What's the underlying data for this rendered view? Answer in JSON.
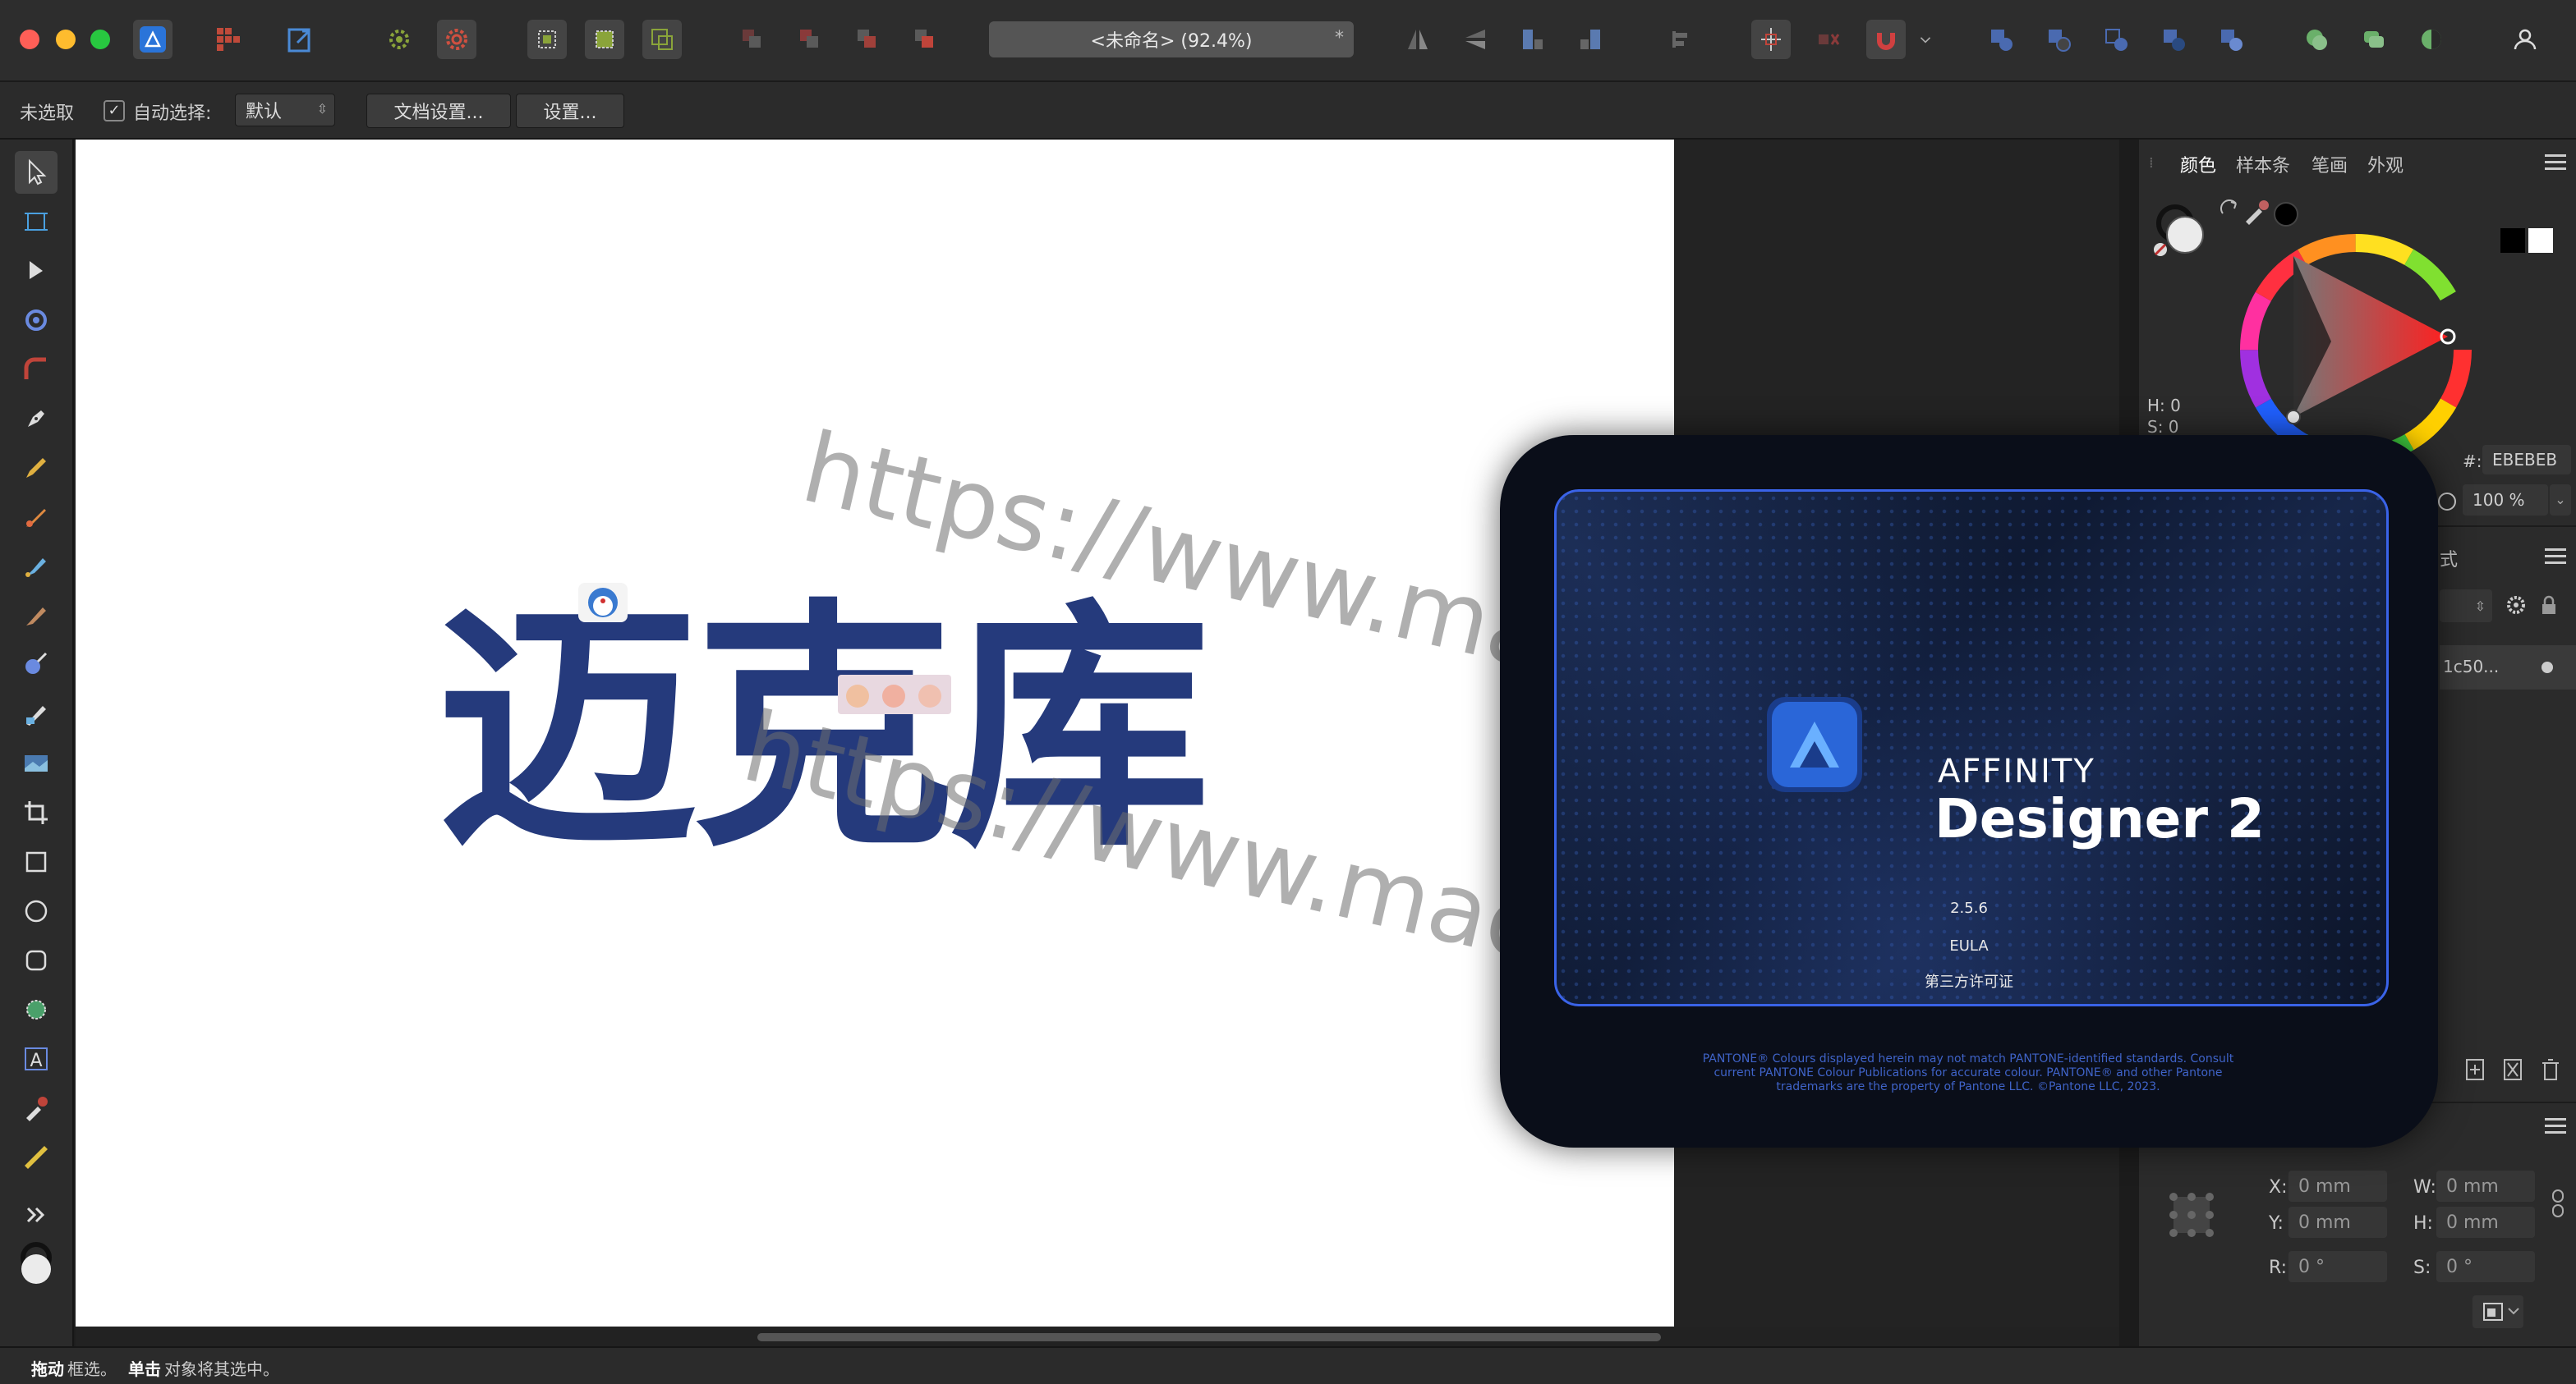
{
  "window": {
    "document_title": "<未命名> (92.4%)",
    "modified_marker": "*"
  },
  "context_toolbar": {
    "selection_status": "未选取",
    "auto_select_label": "自动选择:",
    "auto_select_value": "默认",
    "document_setup_button": "文档设置...",
    "settings_button": "设置..."
  },
  "canvas": {
    "artwork_text": "迈克库",
    "watermark_text": "https://www.macku.pro/"
  },
  "right_panel": {
    "tabs": [
      {
        "label": "颜色",
        "active": true
      },
      {
        "label": "样本条",
        "active": false
      },
      {
        "label": "笔画",
        "active": false
      },
      {
        "label": "外观",
        "active": false
      }
    ],
    "color": {
      "h_label": "H: 0",
      "s_label": "S: 0",
      "hex_label": "#:",
      "hex_value": "EBEBEB",
      "opacity": "100 %",
      "fill_color": "#ebebeb"
    },
    "layers": {
      "partial_tab": "式",
      "layer_name": "1c50..."
    },
    "transform": {
      "x_label": "X:",
      "x_value": "0 mm",
      "y_label": "Y:",
      "y_value": "0 mm",
      "w_label": "W:",
      "w_value": "0 mm",
      "h_label": "H:",
      "h_value": "0 mm",
      "r_label": "R:",
      "r_value": "0 °",
      "s_label": "S:",
      "s_value": "0 °"
    }
  },
  "splash": {
    "brand_line1": "AFFINITY",
    "brand_line2": "Designer 2",
    "version": "2.5.6",
    "eula": "EULA",
    "third_party": "第三方许可证",
    "pantone_notice": "PANTONE® Colours displayed herein may not match PANTONE-identified standards. Consult current PANTONE Colour Publications for accurate colour. PANTONE® and other Pantone trademarks are the property of Pantone LLC. ©Pantone LLC, 2023."
  },
  "status_bar": {
    "drag_bold": "拖动",
    "drag_text": " 框选。",
    "click_bold": "单击",
    "click_text": " 对象将其选中。"
  }
}
